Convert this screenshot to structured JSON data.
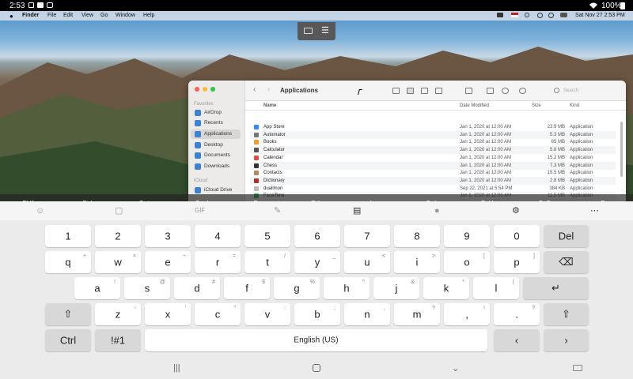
{
  "status": {
    "time": "2:53",
    "battery": "100%"
  },
  "menubar": {
    "app": "Finder",
    "items": [
      "File",
      "Edit",
      "View",
      "Go",
      "Window",
      "Help"
    ],
    "clock": "Sat Nov 27  2:53 PM"
  },
  "finder": {
    "title": "Applications",
    "search_placeholder": "Search",
    "sidebar": {
      "favorites_header": "Favorites",
      "items": [
        "AirDrop",
        "Recents",
        "Applications",
        "Desktop",
        "Documents",
        "Downloads"
      ],
      "icloud_header": "iCloud",
      "icloud_item": "iCloud Drive"
    },
    "columns": {
      "name": "Name",
      "date": "Date Modified",
      "size": "Size",
      "kind": "Kind"
    },
    "rows": [
      {
        "name": "App Store",
        "date": "Jan 1, 2020 at 12:00 AM",
        "size": "23.9 MB",
        "kind": "Application"
      },
      {
        "name": "Automator",
        "date": "Jan 1, 2020 at 12:00 AM",
        "size": "5.3 MB",
        "kind": "Application"
      },
      {
        "name": "Books",
        "date": "Jan 1, 2020 at 12:00 AM",
        "size": "85 MB",
        "kind": "Application"
      },
      {
        "name": "Calculator",
        "date": "Jan 1, 2020 at 12:00 AM",
        "size": "5.8 MB",
        "kind": "Application"
      },
      {
        "name": "Calendar",
        "date": "Jan 1, 2020 at 12:00 AM",
        "size": "15.2 MB",
        "kind": "Application"
      },
      {
        "name": "Chess",
        "date": "Jan 1, 2020 at 12:00 AM",
        "size": "7.3 MB",
        "kind": "Application"
      },
      {
        "name": "Contacts",
        "date": "Jan 1, 2020 at 12:00 AM",
        "size": "15.5 MB",
        "kind": "Application"
      },
      {
        "name": "Dictionary",
        "date": "Jan 1, 2020 at 12:00 AM",
        "size": "2.8 MB",
        "kind": "Application"
      },
      {
        "name": "duallmon",
        "date": "Sep 22, 2021 at 5:54 PM",
        "size": "384 KB",
        "kind": "Application"
      },
      {
        "name": "FaceTime",
        "date": "Jan 1, 2020 at 12:00 AM",
        "size": "11.5 MB",
        "kind": "Application"
      },
      {
        "name": "Find My",
        "date": "Jan 1, 2020 at 12:00 AM",
        "size": "12.3 MB",
        "kind": "Application"
      }
    ]
  },
  "special_keys": [
    "Shift",
    "Ctrl",
    "Opt",
    "Cmd",
    "Esc",
    "Tab",
    "Ins",
    "Del",
    "PgUp",
    "PgDn",
    "Fn"
  ],
  "keyboard": {
    "row1": [
      "1",
      "2",
      "3",
      "4",
      "5",
      "6",
      "7",
      "8",
      "9",
      "0",
      "Del"
    ],
    "row2": [
      {
        "k": "q",
        "s": "+"
      },
      {
        "k": "w",
        "s": "×"
      },
      {
        "k": "e",
        "s": "÷"
      },
      {
        "k": "r",
        "s": "="
      },
      {
        "k": "t",
        "s": "/"
      },
      {
        "k": "y",
        "s": "_"
      },
      {
        "k": "u",
        "s": "<"
      },
      {
        "k": "i",
        "s": ">"
      },
      {
        "k": "o",
        "s": "["
      },
      {
        "k": "p",
        "s": "]"
      }
    ],
    "row3": [
      {
        "k": "a",
        "s": "!"
      },
      {
        "k": "s",
        "s": "@"
      },
      {
        "k": "d",
        "s": "#"
      },
      {
        "k": "f",
        "s": "$"
      },
      {
        "k": "g",
        "s": "%"
      },
      {
        "k": "h",
        "s": "^"
      },
      {
        "k": "j",
        "s": "&"
      },
      {
        "k": "k",
        "s": "*"
      },
      {
        "k": "l",
        "s": "("
      },
      {
        "k": "'",
        "s": ")"
      }
    ],
    "row4": [
      {
        "k": "z",
        "s": "-"
      },
      {
        "k": "x",
        "s": "'"
      },
      {
        "k": "c",
        "s": "\""
      },
      {
        "k": "v",
        "s": ":"
      },
      {
        "k": "b",
        "s": ";"
      },
      {
        "k": "n",
        "s": ","
      },
      {
        "k": "m",
        "s": "?"
      },
      {
        "k": ",",
        "s": "!"
      },
      {
        "k": ".",
        "s": "?"
      }
    ],
    "ctrl": "Ctrl",
    "symbols": "!#1",
    "space": "English (US)",
    "left": "‹",
    "right": "›"
  },
  "icons": {
    "shift": "shift-arrow-icon",
    "backspace": "backspace-icon",
    "enter": "enter-icon"
  }
}
